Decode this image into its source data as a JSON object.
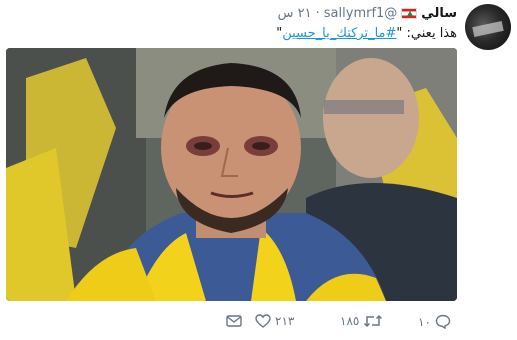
{
  "tweet": {
    "display_name": "سالي",
    "handle": "@sallymrf1",
    "separator": "·",
    "time": "٢١ س",
    "text_prefix": "هذا يعني: \"",
    "hashtag": "#ما_تركتك_يا_حسين",
    "text_suffix": "\"",
    "media": {
      "description_icon": "photo-icon"
    },
    "actions": {
      "reply_count": "١٠",
      "retweet_count": "١٨٥",
      "like_count": "٢١٣"
    }
  },
  "colors": {
    "link": "#1b95e0",
    "muted": "#657786",
    "text": "#14171a",
    "flag_red": "#e0201f",
    "flag_green": "#1e8c3a",
    "scarf_yellow": "#f2d21b"
  },
  "icons": [
    "reply-icon",
    "retweet-icon",
    "heart-icon",
    "envelope-icon",
    "lebanon-flag-icon"
  ]
}
